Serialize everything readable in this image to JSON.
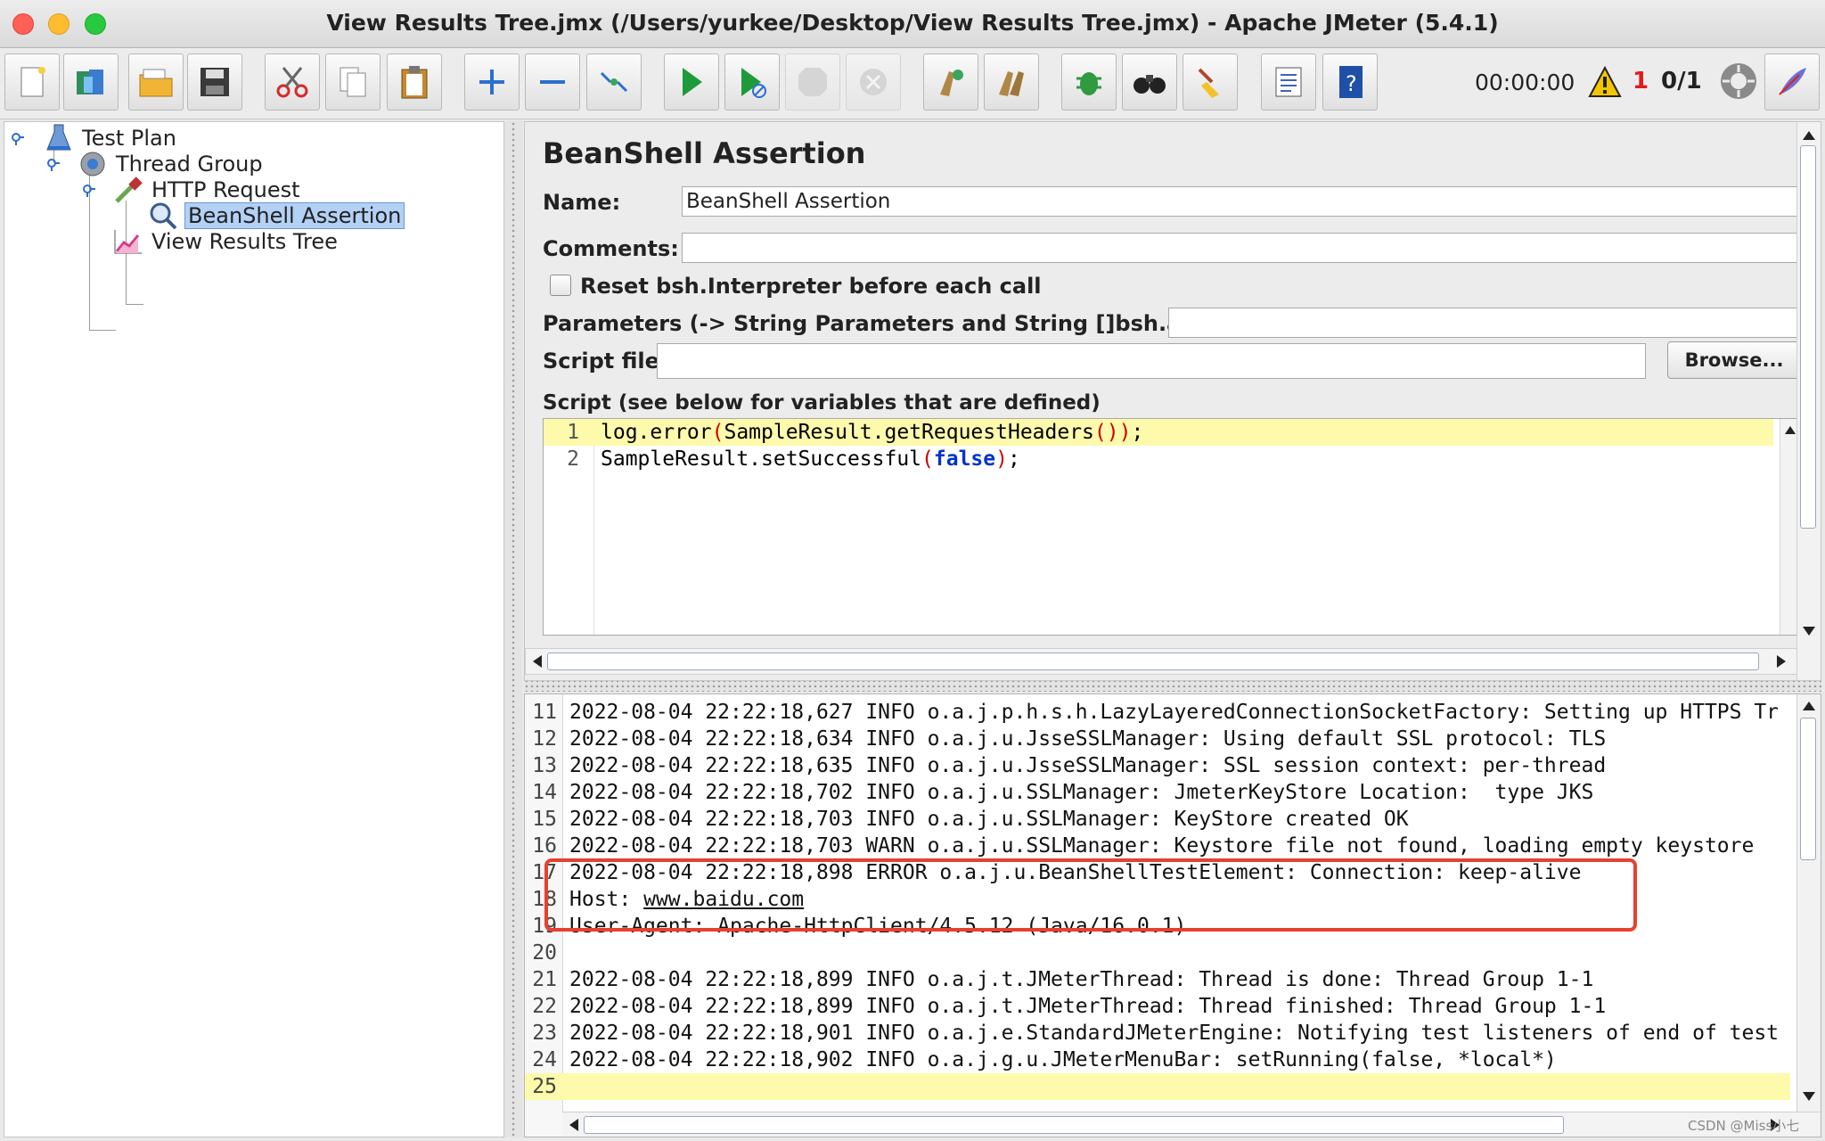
{
  "window": {
    "title": "View Results Tree.jmx (/Users/yurkee/Desktop/View Results Tree.jmx) - Apache JMeter (5.4.1)"
  },
  "toolbar": {
    "buttons": [
      "new",
      "templates",
      "open",
      "save",
      "cut",
      "copy",
      "paste",
      "expand-all",
      "collapse-all",
      "toggle",
      "start",
      "start-no-timers",
      "stop",
      "shutdown",
      "clear",
      "clear-all",
      "debug",
      "search",
      "reset-search",
      "function-helper",
      "help"
    ],
    "elapsed_time": "00:00:00",
    "error_count": "1",
    "thread_count": "0/1"
  },
  "tree": {
    "nodes": [
      {
        "label": "Test Plan",
        "icon": "flask-icon"
      },
      {
        "label": "Thread Group",
        "icon": "gear-icon"
      },
      {
        "label": "HTTP Request",
        "icon": "pipette-icon"
      },
      {
        "label": "BeanShell Assertion",
        "icon": "magnifier-icon",
        "selected": true
      },
      {
        "label": "View Results Tree",
        "icon": "graph-icon"
      }
    ]
  },
  "assertion": {
    "title": "BeanShell Assertion",
    "name_label": "Name:",
    "name_value": "BeanShell Assertion",
    "comments_label": "Comments:",
    "comments_value": "",
    "reset_label": "Reset bsh.Interpreter before each call",
    "reset_checked": false,
    "parameters_label": "Parameters (-> String Parameters and String []bsh.args)",
    "parameters_value": "",
    "script_file_label": "Script file",
    "script_file_value": "",
    "browse_label": "Browse...",
    "script_label": "Script (see below for variables that are defined)",
    "script_lines": [
      {
        "num": "1",
        "a": "log.error",
        "b": "(",
        "c": "SampleResult.getRequestHeaders",
        "d": "()",
        "e": ")",
        "f": ";"
      },
      {
        "num": "2",
        "a": "SampleResult.setSuccessful",
        "b": "(",
        "c": "false",
        "d": ")",
        "e": ";"
      }
    ]
  },
  "log": {
    "lines": [
      {
        "num": "11",
        "text": "2022-08-04 22:22:18,627 INFO o.a.j.p.h.s.h.LazyLayeredConnectionSocketFactory: Setting up HTTPS Tr"
      },
      {
        "num": "12",
        "text": "2022-08-04 22:22:18,634 INFO o.a.j.u.JsseSSLManager: Using default SSL protocol: TLS"
      },
      {
        "num": "13",
        "text": "2022-08-04 22:22:18,635 INFO o.a.j.u.JsseSSLManager: SSL session context: per-thread"
      },
      {
        "num": "14",
        "text": "2022-08-04 22:22:18,702 INFO o.a.j.u.SSLManager: JmeterKeyStore Location:  type JKS"
      },
      {
        "num": "15",
        "text": "2022-08-04 22:22:18,703 INFO o.a.j.u.SSLManager: KeyStore created OK"
      },
      {
        "num": "16",
        "text": "2022-08-04 22:22:18,703 WARN o.a.j.u.SSLManager: Keystore file not found, loading empty keystore"
      },
      {
        "num": "17",
        "text": "2022-08-04 22:22:18,898 ERROR o.a.j.u.BeanShellTestElement: Connection: keep-alive"
      },
      {
        "num": "18",
        "text": "Host: ",
        "link": "www.baidu.com"
      },
      {
        "num": "19",
        "text": "User-Agent: Apache-HttpClient/4.5.12 (Java/16.0.1)"
      },
      {
        "num": "20",
        "text": ""
      },
      {
        "num": "21",
        "text": "2022-08-04 22:22:18,899 INFO o.a.j.t.JMeterThread: Thread is done: Thread Group 1-1"
      },
      {
        "num": "22",
        "text": "2022-08-04 22:22:18,899 INFO o.a.j.t.JMeterThread: Thread finished: Thread Group 1-1"
      },
      {
        "num": "23",
        "text": "2022-08-04 22:22:18,901 INFO o.a.j.e.StandardJMeterEngine: Notifying test listeners of end of test"
      },
      {
        "num": "24",
        "text": "2022-08-04 22:22:18,902 INFO o.a.j.g.u.JMeterMenuBar: setRunning(false, *local*)"
      },
      {
        "num": "25",
        "text": ""
      }
    ]
  },
  "watermark": "CSDN @Miss小七",
  "colors": {
    "selection": "#b3d1f5",
    "current_line": "#fdfaac",
    "error_box": "#e8402f",
    "error_count": "#e21b1b"
  }
}
